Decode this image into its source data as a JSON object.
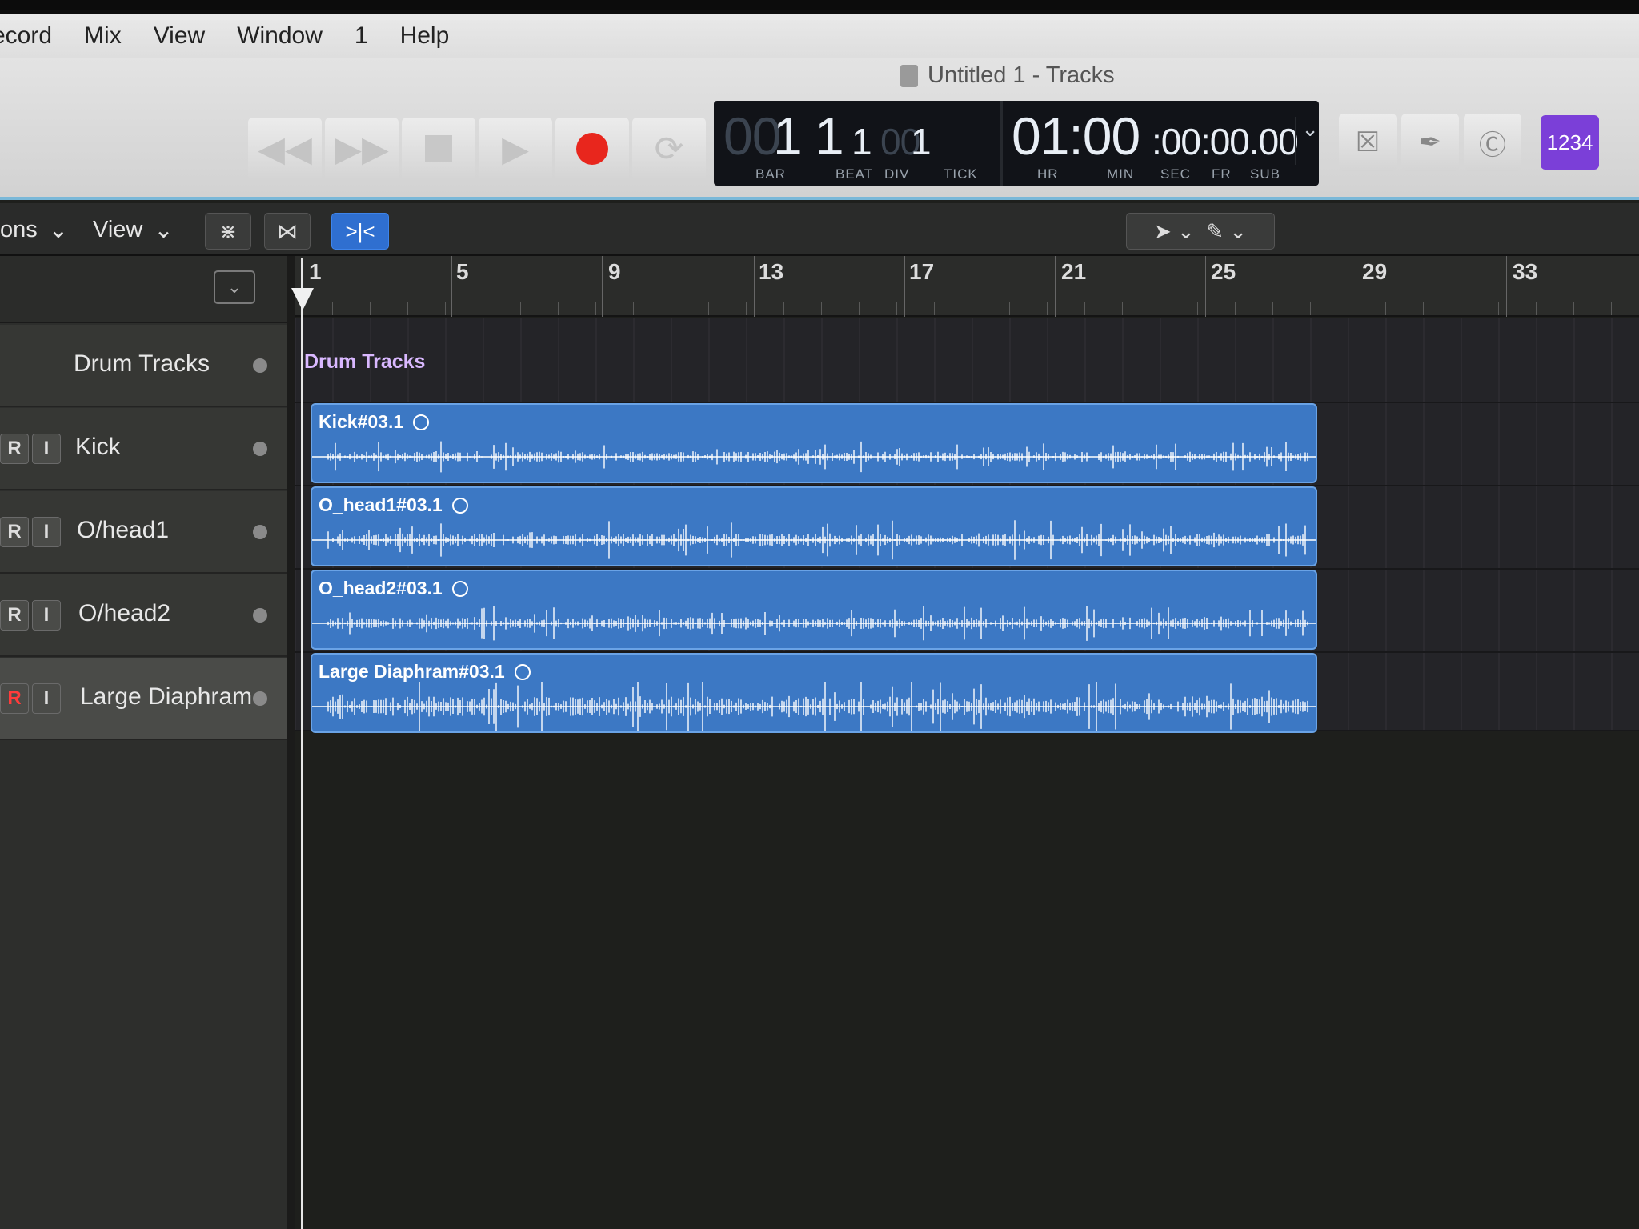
{
  "menu": [
    "ecord",
    "Mix",
    "View",
    "Window",
    "1",
    "Help"
  ],
  "window_title": "Untitled 1 - Tracks",
  "lcd": {
    "bar_dim": "00",
    "bar": "1",
    "beat": "1",
    "div": "1",
    "tick_dim": "00",
    "tick": "1",
    "time_big": "01:00",
    "time_small": ":00:00.00",
    "labels": {
      "bar": "BAR",
      "beat": "BEAT",
      "div": "DIV",
      "tick": "TICK",
      "hr": "HR",
      "min": "MIN",
      "sec": "SEC",
      "fr": "FR",
      "sub": "SUB"
    }
  },
  "count_in_badge": "1234",
  "toolbar": {
    "options_label": "ons",
    "view_label": "View"
  },
  "ruler_bars": [
    "1",
    "5",
    "9",
    "13",
    "17",
    "21",
    "25",
    "29",
    "33"
  ],
  "tracks": [
    {
      "name": "Drum Tracks",
      "summary": true
    },
    {
      "name": "Kick",
      "r": "R",
      "i": "I",
      "region": "Kick#03.1"
    },
    {
      "name": "O/head1",
      "r": "R",
      "i": "I",
      "region": "O_head1#03.1"
    },
    {
      "name": "O/head2",
      "r": "R",
      "i": "I",
      "region": "O_head2#03.1"
    },
    {
      "name": "Large Diaphram",
      "r": "R",
      "i": "I",
      "region": "Large Diaphram#03.1",
      "armed": true
    }
  ],
  "summary_region_label": "Drum Tracks",
  "colors": {
    "region_fill": "#3c78c4",
    "record": "#e8261d",
    "count_badge": "#7b3fd8",
    "summary_text": "#d9b8ff"
  }
}
